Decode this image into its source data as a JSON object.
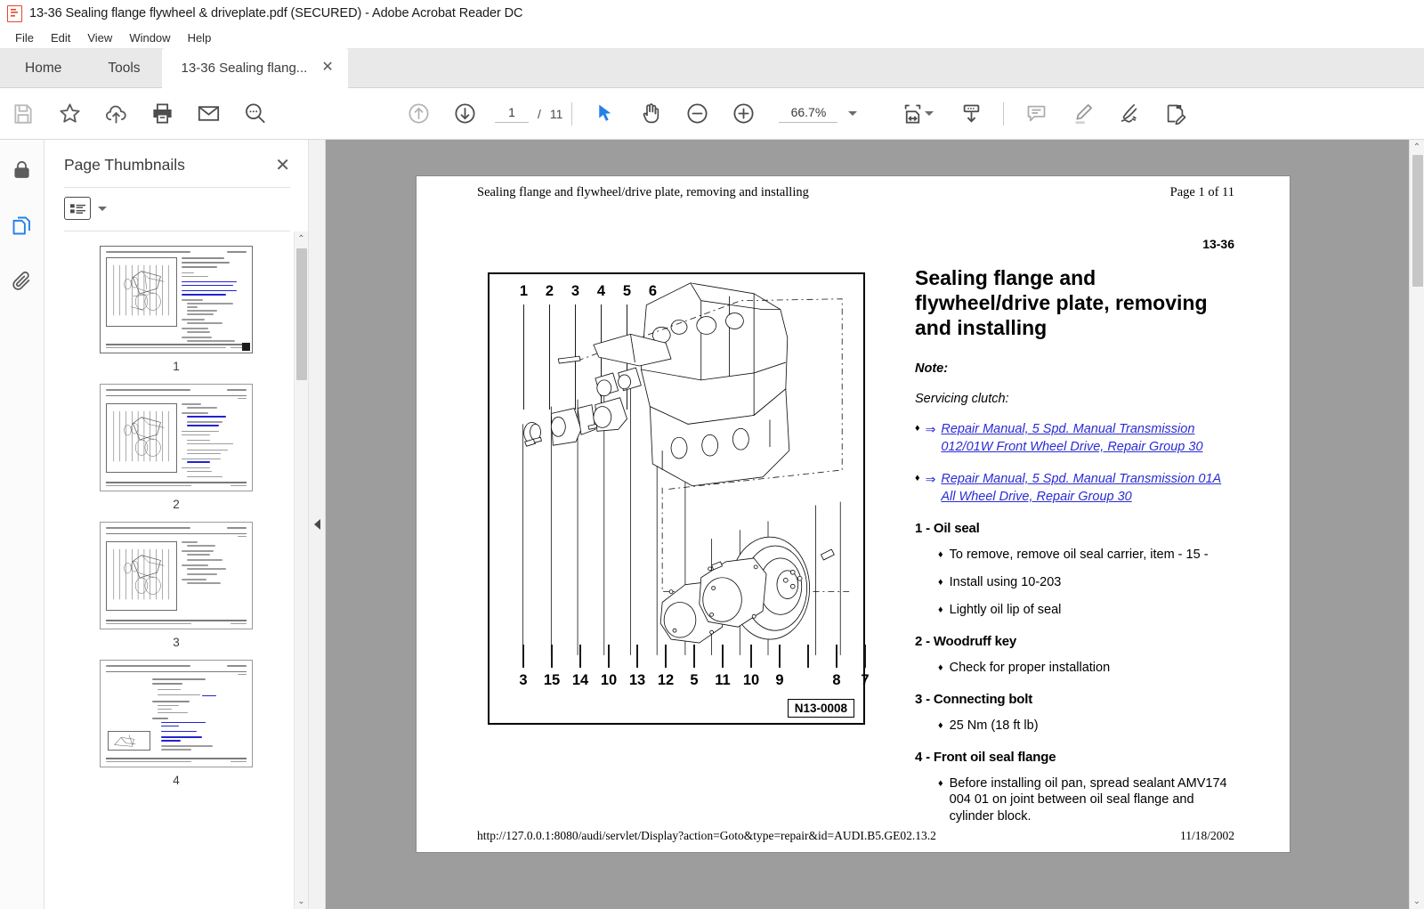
{
  "window": {
    "title": "13-36 Sealing flange flywheel & driveplate.pdf (SECURED) - Adobe Acrobat Reader DC",
    "app_icon": "pdf-document-icon"
  },
  "menubar": {
    "items": [
      "File",
      "Edit",
      "View",
      "Window",
      "Help"
    ]
  },
  "tabs": {
    "home": "Home",
    "tools": "Tools",
    "document": "13-36 Sealing flang...",
    "close_glyph": "✕"
  },
  "toolbar": {
    "left_icons": [
      {
        "name": "save-icon",
        "label": "Save"
      },
      {
        "name": "star-icon",
        "label": "Add to favorites"
      },
      {
        "name": "cloud-upload-icon",
        "label": "Upload to cloud"
      },
      {
        "name": "print-icon",
        "label": "Print"
      },
      {
        "name": "email-icon",
        "label": "Send by email"
      },
      {
        "name": "search-icon",
        "label": "Find"
      }
    ],
    "page_up": "↑",
    "page_down": "↓",
    "page_current": "1",
    "page_sep": "/",
    "page_total": "11",
    "select_tool": "select-cursor-icon",
    "hand_tool": "hand-icon",
    "zoom_out": "−",
    "zoom_in": "+",
    "zoom_level": "66.7%",
    "right_icons": [
      {
        "name": "fit-page-icon",
        "label": "Fit page width"
      },
      {
        "name": "read-mode-icon",
        "label": "Scroll mode"
      },
      {
        "name": "comment-icon",
        "label": "Add comment"
      },
      {
        "name": "highlight-icon",
        "label": "Highlight text"
      },
      {
        "name": "sign-icon",
        "label": "Sign"
      },
      {
        "name": "fill-sign-icon",
        "label": "Fill & Sign"
      }
    ]
  },
  "rail": {
    "items": [
      {
        "name": "security-lock-icon",
        "label": "Security settings",
        "active": false
      },
      {
        "name": "page-thumbnails-icon",
        "label": "Page Thumbnails",
        "active": true
      },
      {
        "name": "attachments-paperclip-icon",
        "label": "Attachments",
        "active": false
      }
    ]
  },
  "thumbnails_panel": {
    "title": "Page Thumbnails",
    "close_glyph": "✕",
    "list_options_label": "List options",
    "pages": [
      {
        "label": "1",
        "selected": true,
        "layout": "figure-and-text"
      },
      {
        "label": "2",
        "selected": false,
        "layout": "figure-and-text"
      },
      {
        "label": "3",
        "selected": false,
        "layout": "figure-and-text"
      },
      {
        "label": "4",
        "selected": false,
        "layout": "text-only"
      }
    ],
    "collapse_label": "Collapse panel"
  },
  "document": {
    "header_left": "Sealing flange and flywheel/drive plate, removing and installing",
    "header_right": "Page 1 of 11",
    "section_number": "13-36",
    "title": "Sealing flange and flywheel/drive plate, removing and installing",
    "note_label": "Note:",
    "note_body": "Servicing clutch:",
    "links": [
      "Repair Manual, 5 Spd. Manual Transmission 012/01W Front Wheel Drive, Repair Group 30",
      "Repair Manual, 5 Spd. Manual Transmission 01A All Wheel Drive, Repair Group 30"
    ],
    "arrow_glyph": "⇒",
    "bullet_glyph": "♦",
    "items": [
      {
        "heading": "1 - Oil seal",
        "bullets": [
          "To remove, remove oil seal carrier, item - 15 -",
          "Install using 10-203",
          "Lightly oil lip of seal"
        ]
      },
      {
        "heading": "2 - Woodruff key",
        "bullets": [
          "Check for proper installation"
        ]
      },
      {
        "heading": "3 - Connecting bolt",
        "bullets": [
          "25 Nm (18 ft lb)"
        ]
      },
      {
        "heading": "4 - Front oil seal flange",
        "bullets": [
          "Before installing oil pan, spread sealant AMV174 004 01 on joint between oil seal flange and cylinder block."
        ]
      }
    ],
    "figure": {
      "callouts_top": [
        "1",
        "2",
        "3",
        "4",
        "5",
        "6"
      ],
      "callouts_bottom": [
        "3",
        "15",
        "14",
        "10",
        "13",
        "12",
        "5",
        "11",
        "10",
        "9",
        "",
        "8",
        "7"
      ],
      "figure_id": "N13-0008",
      "description": "Exploded view of engine cylinder block with sealing flange, oil seal, gaskets and flywheel"
    },
    "footer_url": "http://127.0.0.1:8080/audi/servlet/Display?action=Goto&type=repair&id=AUDI.B5.GE02.13.2",
    "footer_date": "11/18/2002"
  },
  "colors": {
    "accent_blue": "#2680eb",
    "link_blue": "#2b2bd4",
    "viewer_gray": "#9d9d9d",
    "tabstrip_gray": "#e9e9e9",
    "pdf_red": "#e8452c"
  },
  "scrollbars": {
    "up_glyph": "⌃",
    "down_glyph": "⌄"
  }
}
